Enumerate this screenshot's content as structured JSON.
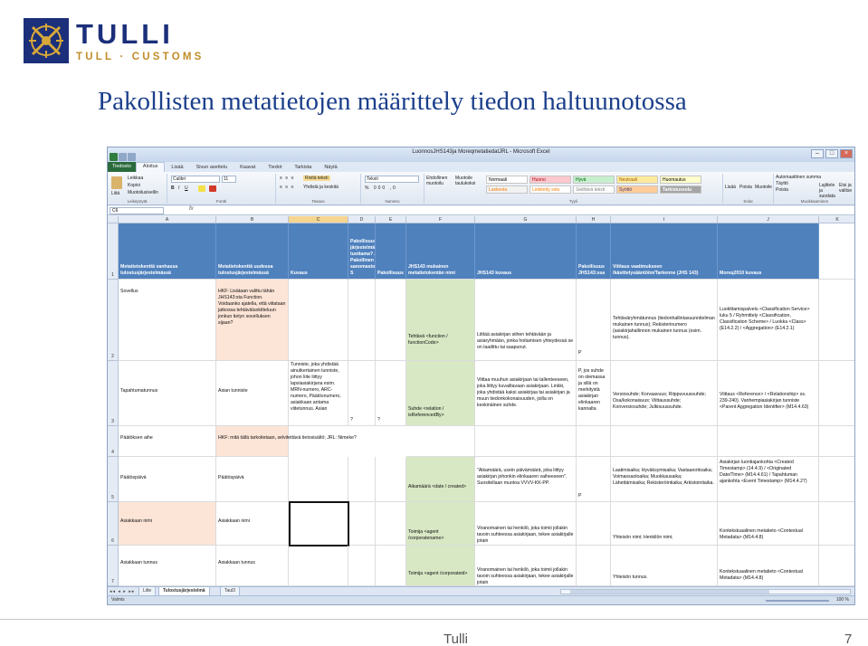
{
  "logo": {
    "brand": "TULLI",
    "sub": "TULL · CUSTOMS"
  },
  "slide": {
    "title": "Pakollisten metatietojen määrittely tiedon haltuunotossa",
    "footer": "Tulli",
    "page": "7"
  },
  "excel": {
    "title": "LuonnosJHS143ja MoreqmetatiedatJRL - Microsoft Excel",
    "tabs": [
      "Aloitus",
      "Lisää",
      "Sivun asettelu",
      "Kaavat",
      "Tiedot",
      "Tarkista",
      "Näytä"
    ],
    "file_tab": "Tiedosto",
    "ribbon": {
      "paste": "Liitä",
      "cut": "Leikkaa",
      "copy": "Kopioi",
      "format_painter": "Muotoilusivellin",
      "font": "Calibri",
      "size": "11",
      "wrap": "Rivitä teksti",
      "merge": "Yhdistä ja keskitä",
      "number_format": "Teksti",
      "cond_format": "Ehdollinen muotoilu",
      "format_table": "Muotoile taulukoksi",
      "styles": [
        "Normaali",
        "Huono",
        "Hyvä",
        "Neutraali",
        "Huomautus",
        "Laskenta",
        "Linkitetty solu",
        "Selittävä teksti",
        "Syöttö",
        "Tarkistussolu"
      ],
      "insert": "Lisää",
      "delete": "Poista",
      "format": "Muotoile",
      "autosum": "Automaattinen summa",
      "fill": "Täyttö",
      "clear": "Poista",
      "sort": "Lajittele ja suodata",
      "find": "Etsi ja valitse",
      "groups": [
        "Leikepöytä",
        "Fontti",
        "Tasaus",
        "Numero",
        "Tyyli",
        "Solut",
        "Muokkaaminen"
      ]
    },
    "namebox": "C6",
    "fx": "fx",
    "columns": [
      "A",
      "B",
      "C",
      "D",
      "E",
      "F",
      "G",
      "H",
      "I",
      "J",
      "K"
    ],
    "rows": [
      "1",
      "2",
      "3",
      "4",
      "5",
      "6",
      "7"
    ],
    "header": {
      "A": "Metatietokenttä vanhassa tulostusjärjestelmässä",
      "B": "Metatietokenttä uudessa tulostusjärjestelmässä",
      "C": "Kuvaus",
      "D": "Pakollisuus järjestelmän tuottama? / Pakollinen sanomaston S",
      "E": "Pakollisuus",
      "F": "JHS143 mukainen metatietokentän nimi",
      "G": "JHS143 kuvaus",
      "H": "Pakollisuus JHS143:ssa",
      "I": "Viittaus vaatimukseen /käsittelysääntöön/Tarkenne (JHS 143)",
      "J": "Moreq2010 kuvaus"
    },
    "data": {
      "r2": {
        "A": "Sovellus",
        "B": "HKF: Lisätaan valittu tähän JHS143:sta Function. Voidaanko ajatella, että viitataan jatkossa tehtäväluokitteluun jonkun tietyn sovelluksen sijaan?",
        "F": "Tehtävä <function / functionCode>",
        "G": "Liittää asiakirjan siihen tehtävään ja asiaryhmään, jonka hoitamisen yhteydessä se on laadittu tai saapunut.",
        "H": "P",
        "I": "Tehtäväryhmätunnus (tiedonhallintasuunnitelman mukainen tunnus); Rekisterinumero (asiakirjahallinnon mukainen tunnus (esim. tunnus).",
        "J": "Luokittamispalvelu <Classification Service> luku 5 / Ryhmittely <Classification, Classification Scheme> / Luokka <Class> (E14.2.2) / <Aggregation> (E14.2.1)"
      },
      "r3": {
        "A": "Tapahtumatunnus",
        "B": "Asian tunniste",
        "C": "Tunniste, joka yhdistää ainutkertainen tunniste, johon liite liittyy lapsiasiakirjana esim. MRN-numero, ARC-numero, Päätösnumero, asiakkaan antama viitetunnus. Asian",
        "D": "?",
        "E": "?",
        "F": "Suhde <relation / isReferencedBy>",
        "G": "Viittaa muuhun asiakirjaan tai tallenteeseen, joka liittyy kuvailtavaan asiakirjaan. Linkki, joka yhdistää kaksi asiakirjaa tai asiakirjan ja muun tiedonkokonaisuuden, joilla on keskinäinen suhde.",
        "H": "P, jos suhde on olemassa ja sillä on merkitystä asiakirjan elinkaaren kannalta",
        "I": "Versiosuhde; Korvaavuus; Riippuvuussuhde; Osa/kokonaisuus; Viittaussuhde; Konversiosuhde; Julkisuussuhde.",
        "J": "Viittaus <Reference> / <Relationship> ss. 239-240). Vanhempiasiakirjan tunniste <Parent Aggregation Identifier> (M14.4.63)"
      },
      "r4": {
        "A": "Päätöksen aihe",
        "B": "HKF: mitä tällä tarkoitetaan, selvitettävä tietosisältö; JRL: Nimeke?"
      },
      "r5": {
        "A": "Päätöspäivä",
        "B": "Päätöspäivä",
        "F": "Aikamäärä <date / created>",
        "G": "\"Aikamäärä, usein päivämäärä, joka liittyy asiakirjan johonkin elinkaaren vaiheeseen\". Suositellaan muotoa VVVV-KK-PP.",
        "H": "P",
        "I": "Laatimisaika; Hyväksymisaika; Vastaanottoaika; Voimassaoloaika; Muokkausaika; Lähettämisaika; Rekisteröintiaika; Arkistointiaika.",
        "J": "Asiakirjan luontiajankohta <Created Timestamp> (14.4.9) / <Originated Date/Time> (M14.4.61) / Tapahtuman ajankohta <Event Timestamp> (M14.4.27)"
      },
      "r6": {
        "A": "Asiakkaan nimi",
        "B": "Asiakkaan nimi",
        "F": "Toimija <agent /corporatename>",
        "G": "Viranomainen tai henkilö, joka toimii jollakin tavoin suhteessa asiakirjaan, tekee asiakirjalle jotain",
        "I": "Yhteisön nimi; Henkilön nimi;",
        "J": "Kontekstuaalinen metatieto <Contextual Metadata> (M14.4.8)"
      },
      "r7": {
        "A": "Asiakkaan tunnus",
        "B": "Asiakkaan tunnus",
        "F": "Toimija <agent /corporateid>",
        "G": "Viranomainen tai henkilö, joka toimii jollakin tavoin suhteessa asiakirjaan, tekee asiakirjalle jotain",
        "I": "Yhteisön tunnus.",
        "J": "Kontekstuaalinen metatieto <Contextual Metadata> (M14.4.8)"
      }
    },
    "sheet_tabs": [
      "Liite",
      "Tulostusjärjestelmä",
      "Taul3"
    ],
    "status": "Valmis",
    "zoom": "100 %"
  }
}
